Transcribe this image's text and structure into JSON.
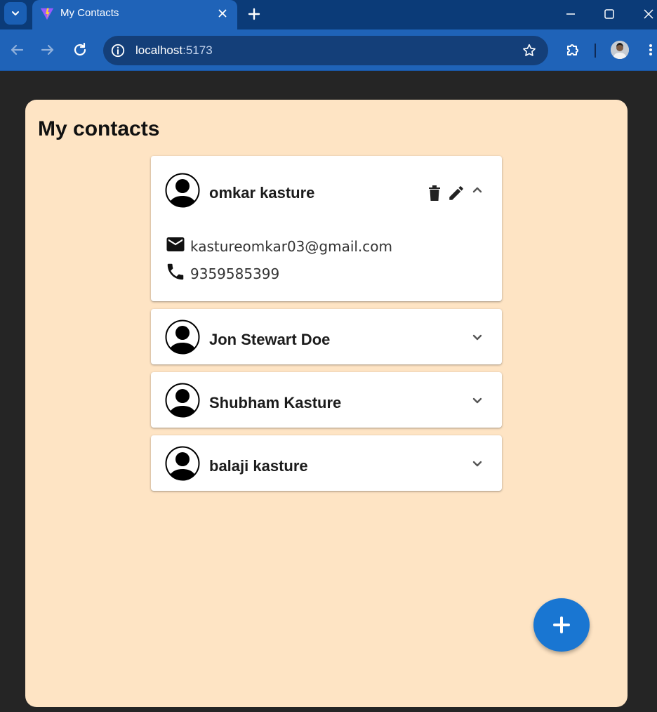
{
  "browser": {
    "tab_title": "My Contacts",
    "url_host": "localhost",
    "url_port": ":5173"
  },
  "page": {
    "title": "My contacts"
  },
  "contacts": [
    {
      "name": "omkar kasture",
      "email": "kastureomkar03@gmail.com",
      "phone": "9359585399",
      "expanded": true
    },
    {
      "name": "Jon Stewart Doe",
      "expanded": false
    },
    {
      "name": "Shubham Kasture",
      "expanded": false
    },
    {
      "name": "balaji kasture",
      "expanded": false
    }
  ],
  "icons": {
    "tab_search": "chevron-down-icon",
    "favicon": "vite-logo-icon",
    "tab_close": "close-icon",
    "new_tab": "plus-icon",
    "back": "arrow-left-icon",
    "forward": "arrow-right-icon",
    "reload": "reload-icon",
    "site_info": "info-icon",
    "bookmark": "star-icon",
    "extensions": "puzzle-icon",
    "contact_avatar": "person-avatar-icon",
    "delete": "trash-icon",
    "edit": "pencil-icon",
    "expand": "chevron-down-icon",
    "collapse": "chevron-up-icon",
    "email": "mail-icon",
    "phone": "phone-icon",
    "add": "plus-icon"
  },
  "colors": {
    "browser_frame": "#0b3b78",
    "toolbar": "#1f63b8",
    "page_background": "#252525",
    "panel": "#fee4c4",
    "fab": "#1976d2"
  }
}
